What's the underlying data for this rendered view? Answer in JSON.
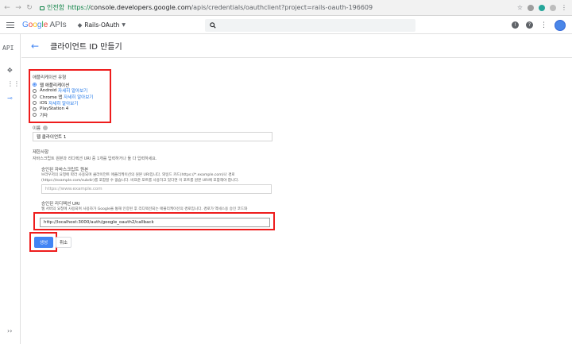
{
  "browser": {
    "secure_label": "인전함",
    "url_scheme": "https://",
    "url_host": "console.developers.google.com",
    "url_path": "/apis/credentials/oauthclient?project=rails-oauth-196609"
  },
  "header": {
    "logo_g": "G",
    "logo_o1": "o",
    "logo_o2": "o",
    "logo_g2": "g",
    "logo_l": "l",
    "logo_e": "e",
    "logo_apis": " APIs",
    "project_name": "Rails-OAuth"
  },
  "sidebar": {
    "api_label": "API"
  },
  "page": {
    "title": "클라이언트 ID 만들기"
  },
  "app_type": {
    "label": "애플리케이션 유형",
    "options": [
      {
        "label": "웹 애플리케이션",
        "link": "",
        "selected": true
      },
      {
        "label": "Android",
        "link": "자세히 알아보기",
        "selected": false
      },
      {
        "label": "Chrome 앱",
        "link": "자세히 알아보기",
        "selected": false
      },
      {
        "label": "iOS",
        "link": "자세히 알아보기",
        "selected": false
      },
      {
        "label": "PlayStation 4",
        "link": "",
        "selected": false
      },
      {
        "label": "기타",
        "link": "",
        "selected": false
      }
    ]
  },
  "name_field": {
    "label": "이름",
    "value": "웹 클라이언트 1"
  },
  "restrictions": {
    "title": "제한사항",
    "desc": "자바스크립트 원본과 리디렉션 URI 중 1개를 입력하거나 둘 다 입력하세요.",
    "js_origins": {
      "label": "승인된 자바스크립트 원본",
      "help1": "브라우저의 요청에 따라 사용되며 클라이언트 애플리케이션의 원본 URI입니다. 와일드 카드(https://*.example.com)나 경로",
      "help2": "(https://example.com/subdir)를 포함할 수 없습니다. 비표준 포트를 사용하고 있다면 이 포트를 원본 URI에 포함해야 합니다.",
      "placeholder": "https://www.example.com"
    },
    "redirect_uris": {
      "label": "승인된 리디렉션 URI",
      "help1": "웹 서버의 요청에 사용되며 사용자가 Google을 통해 인증된 후 리디렉션되는 애플리케이션의 경로입니다. 경로가 액세스용 승인 코드와",
      "value": "http://localhost:3000/auth/google_oauth2/callback"
    }
  },
  "buttons": {
    "create": "생성",
    "cancel": "취소"
  }
}
